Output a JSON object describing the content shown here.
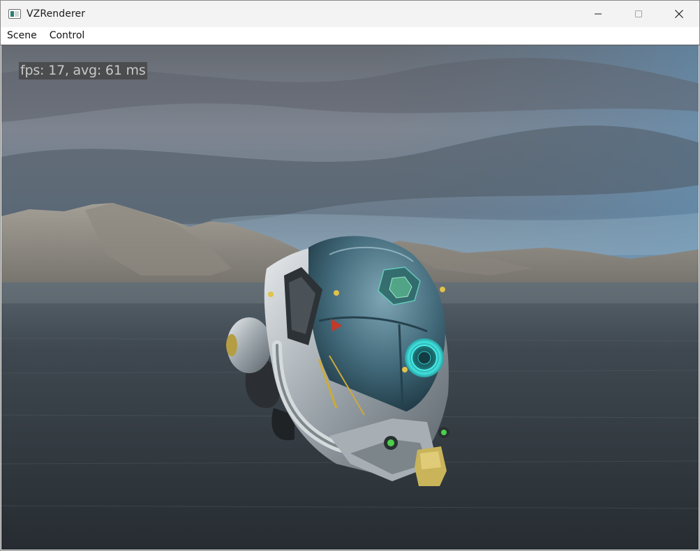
{
  "window": {
    "title": "VZRenderer",
    "controls": {
      "minimize_icon": "minimize-icon",
      "maximize_icon": "maximize-icon",
      "close_icon": "close-icon"
    }
  },
  "menubar": {
    "items": [
      {
        "label": "Scene"
      },
      {
        "label": "Control"
      }
    ]
  },
  "viewport": {
    "overlay_text": "fps: 17, avg: 61 ms",
    "scene": "3D sci-fi helmet model floating over water with mountains and cloudy sky"
  },
  "colors": {
    "titlebar_bg": "#f3f3f3",
    "menubar_bg": "#ffffff",
    "overlay_bg": "#464646",
    "overlay_text": "#c9c9c9",
    "visor_glow": "#3fe3e0",
    "helmet_tip": "#c9b45a"
  }
}
